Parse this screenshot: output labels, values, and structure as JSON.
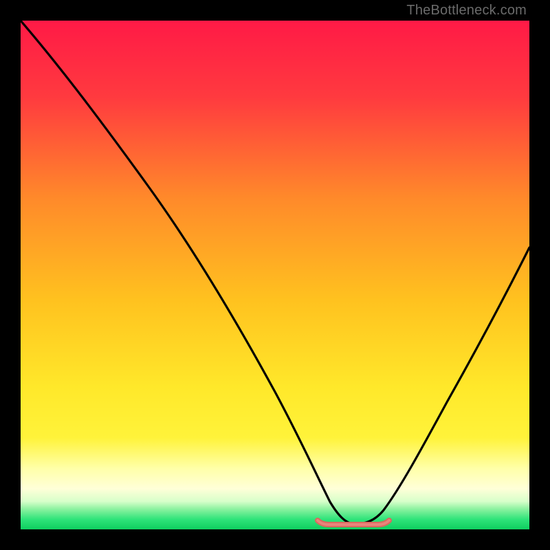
{
  "watermark": "TheBottleneck.com",
  "colors": {
    "top": "#ff1a46",
    "mid_upper": "#ff6a2a",
    "mid": "#ffd21f",
    "mid_lower": "#fff33a",
    "pale_band": "#ffffb0",
    "green": "#15e06b",
    "curve": "#000000",
    "marker_fill": "#d9695f",
    "marker_stroke": "#b8463d"
  },
  "chart_data": {
    "type": "line",
    "title": "",
    "xlabel": "",
    "ylabel": "",
    "xlim": [
      0,
      100
    ],
    "ylim": [
      0,
      100
    ],
    "x": [
      0,
      5,
      10,
      15,
      20,
      25,
      30,
      35,
      40,
      45,
      50,
      55,
      58,
      60,
      63,
      65,
      67,
      70,
      73,
      75,
      80,
      85,
      90,
      95,
      100
    ],
    "y": [
      100,
      92,
      83,
      74,
      65,
      56,
      47,
      38,
      30,
      22,
      15,
      8,
      4,
      2,
      0.5,
      0,
      0.5,
      2,
      6,
      10,
      19,
      29,
      39,
      49,
      58
    ],
    "marker_segment": {
      "x_start": 58,
      "x_end": 72,
      "y": 0.5
    },
    "note": "Values are read-off estimates from the rendered image; axes have no visible tick labels."
  }
}
